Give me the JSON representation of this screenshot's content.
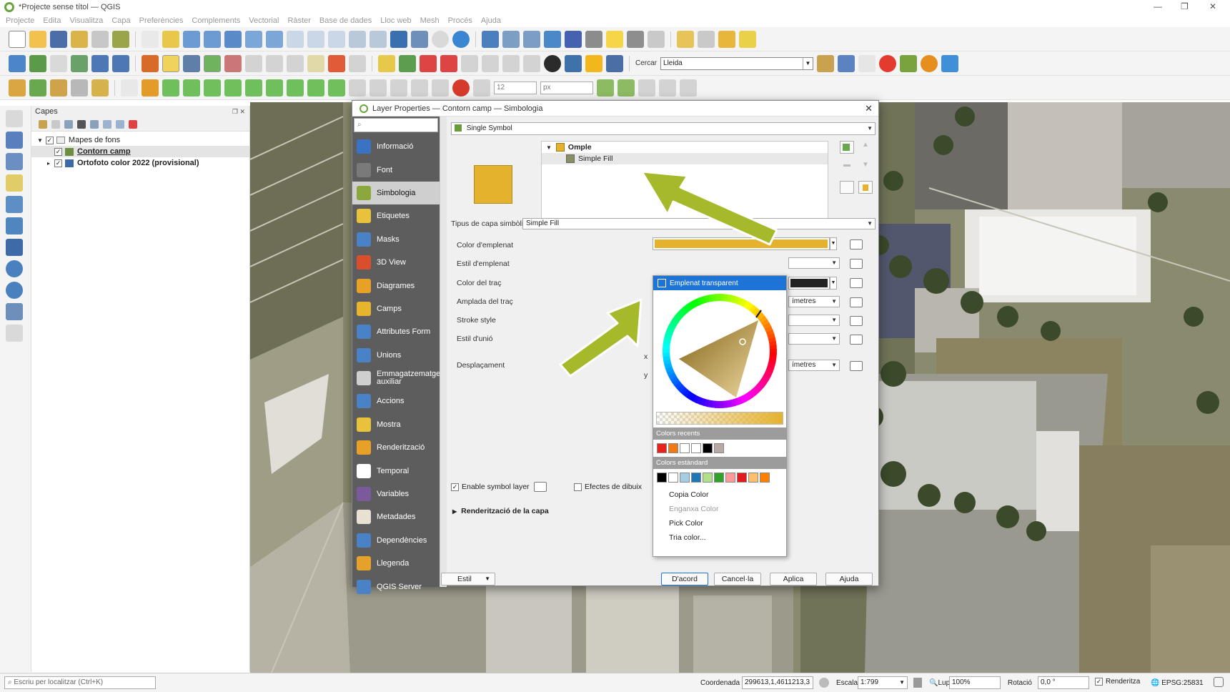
{
  "window": {
    "title": "*Projecte sense títol — QGIS"
  },
  "menu": [
    "Projecte",
    "Edita",
    "Visualitza",
    "Capa",
    "Preferències",
    "Complements",
    "Vectorial",
    "Ràster",
    "Base de dades",
    "Lloc web",
    "Mesh",
    "Procés",
    "Ajuda"
  ],
  "toolbar": {
    "search_label": "Cercar",
    "search_value": "Lleida",
    "size_value": "12",
    "size_unit": "px"
  },
  "layers_panel": {
    "title": "Capes",
    "group": "Mapes de fons",
    "layers": [
      {
        "label": "Contorn camp",
        "checked": true
      },
      {
        "label": "Ortofoto color 2022 (provisional)",
        "checked": true
      }
    ]
  },
  "dialog": {
    "title": "Layer Properties — Contorn camp — Simbologia",
    "renderer": "Single Symbol",
    "sidebar": [
      "Informació",
      "Font",
      "Simbologia",
      "Etiquetes",
      "Masks",
      "3D View",
      "Diagrames",
      "Camps",
      "Attributes Form",
      "Unions",
      "Emmagatzematge auxiliar",
      "Accions",
      "Mostra",
      "Renderització",
      "Temporal",
      "Variables",
      "Metadades",
      "Dependències",
      "Llegenda",
      "QGIS Server"
    ],
    "symbol_tree": {
      "parent": "Omple",
      "child": "Simple Fill"
    },
    "symbol_layer_type_label": "Tipus de capa simbòlica",
    "symbol_layer_type": "Simple Fill",
    "properties": [
      {
        "label": "Color d'emplenat"
      },
      {
        "label": "Estil d'emplenat"
      },
      {
        "label": "Color del traç"
      },
      {
        "label": "Amplada del traç",
        "unit": "ímetres"
      },
      {
        "label": "Stroke style"
      },
      {
        "label": "Estil d'unió"
      },
      {
        "label": "Desplaçament",
        "unit": "ímetres"
      }
    ],
    "offset_x": "x",
    "offset_y": "y",
    "enable_symbol_layer": "Enable symbol layer",
    "draw_effects": "Efectes de dibuix",
    "layer_rendering": "Renderització de la capa",
    "style_button": "Estil",
    "buttons": {
      "ok": "D'acord",
      "cancel": "Cancel·la",
      "apply": "Aplica",
      "help": "Ajuda"
    },
    "fill_color": "#e5b22e"
  },
  "color_popup": {
    "transparent": "Emplenat transparent",
    "recent_title": "Colors recents",
    "recent_colors": [
      "#e8231b",
      "#f07a16",
      "#ffffff",
      "#ffffff",
      "#000000",
      "#b9a9a6"
    ],
    "standard_title": "Colors estàndard",
    "standard_colors": [
      "#000000",
      "#ffffff",
      "#a6cee3",
      "#1f78b4",
      "#b2df8a",
      "#33a02c",
      "#fb9a99",
      "#e31a1c",
      "#fdbf6f",
      "#ff7f00"
    ],
    "menu": [
      {
        "label": "Copia Color",
        "enabled": true
      },
      {
        "label": "Enganxa Color",
        "enabled": false
      },
      {
        "label": "Pick Color",
        "enabled": true
      },
      {
        "label": "Tria color...",
        "enabled": true
      }
    ]
  },
  "statusbar": {
    "locator_placeholder": "Escriu per localitzar (Ctrl+K)",
    "coord_label": "Coordenada",
    "coord_value": "299613,1,4611213,3",
    "scale_label": "Escala",
    "scale_value": "1:799",
    "magnifier_label": "Lupa",
    "magnifier_value": "100%",
    "rotation_label": "Rotació",
    "rotation_value": "0,0 °",
    "render_label": "Renderitza",
    "crs": "EPSG:25831"
  },
  "colors": {
    "accent": "#a6b92a",
    "dialog_sidebar": "#5d5d5d",
    "selection": "#1e73d6"
  }
}
